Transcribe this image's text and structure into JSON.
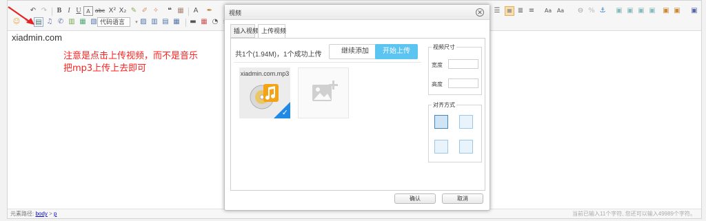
{
  "toolbar": {
    "row1_left": [
      "↶",
      "↷",
      "B",
      "I",
      "U",
      "A",
      "abc",
      "X²",
      "X₂",
      "✎",
      "✐",
      "✧",
      "❝",
      "▦",
      "A",
      "✒"
    ],
    "row1_right": [
      "☰",
      "≡",
      "≣",
      "≡",
      "Aa",
      "Aa",
      "⊖",
      "%",
      "⚓",
      "▣",
      "▣",
      "▣",
      "▣",
      "▣",
      "▣",
      "▣"
    ],
    "row2_left": [
      "☺",
      "✎",
      "▤",
      "♫",
      "✆",
      "▥",
      "▦",
      "▧",
      "▨"
    ],
    "code_language_label": "代码语言",
    "row2_more": [
      "▬",
      "▦",
      "◔",
      "Ω"
    ]
  },
  "content": {
    "text": "xiadmin.com",
    "note_line1": "注意是点击上传视频，而不是音乐",
    "note_line2": "把mp3上传上去即可"
  },
  "statusbar": {
    "path_label": "元素路径:",
    "path_body": "body",
    "path_sep": ">",
    "path_p": "p",
    "word_count": "当前已输入11个字符, 您还可以输入49989个字符。"
  },
  "dialog": {
    "title": "视频",
    "close_glyph": "✕",
    "tabs": [
      "插入视频",
      "上传视频"
    ],
    "upload": {
      "info": "共1个(1.94M)，1个成功上传",
      "continue_label": "继续添加",
      "start_label": "开始上传",
      "file_name": "xiadmin.com.mp3",
      "check_glyph": "✓"
    },
    "size": {
      "legend": "视频尺寸",
      "width_label": "宽度",
      "height_label": "高度"
    },
    "align": {
      "legend": "对齐方式"
    },
    "footer": {
      "ok_label": "确认",
      "cancel_label": "取消"
    }
  },
  "colors": {
    "accent": "#5bc4f0",
    "note": "#ff2020",
    "check": "#1f8ae6"
  }
}
